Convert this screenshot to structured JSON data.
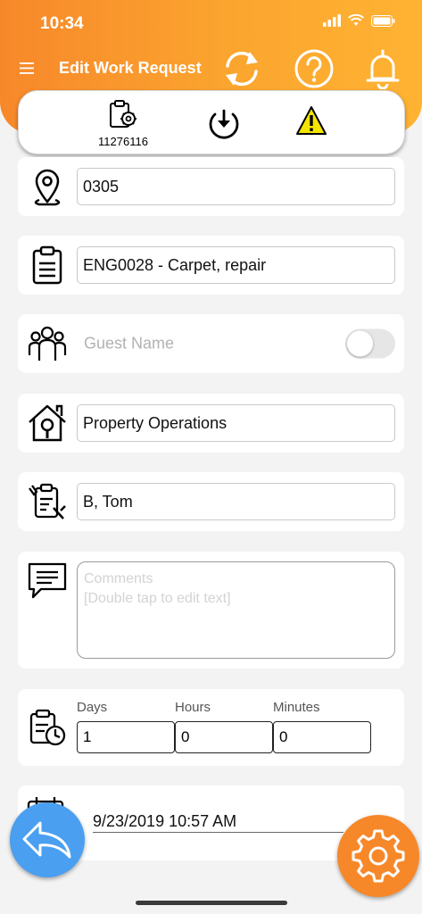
{
  "status_bar": {
    "time": "10:34"
  },
  "header": {
    "title": "Edit Work Request"
  },
  "subbar": {
    "request_number": "11276116"
  },
  "fields": {
    "location": "0305",
    "task": "ENG0028 - Carpet, repair",
    "guest_placeholder": "Guest Name",
    "guest_toggle_on": false,
    "department": "Property Operations",
    "assignee": "B, Tom",
    "comments_placeholder_line1": "Comments",
    "comments_placeholder_line2": "[Double tap to edit text]"
  },
  "duration": {
    "days_label": "Days",
    "hours_label": "Hours",
    "minutes_label": "Minutes",
    "days": "1",
    "hours": "0",
    "minutes": "0"
  },
  "due": {
    "datetime": "9/23/2019 10:57 AM"
  },
  "colors": {
    "header_orange": "#f7882a",
    "back_button_blue": "#4a9ff0",
    "settings_button_orange": "#f7882a",
    "warning_yellow": "#f5e400"
  }
}
